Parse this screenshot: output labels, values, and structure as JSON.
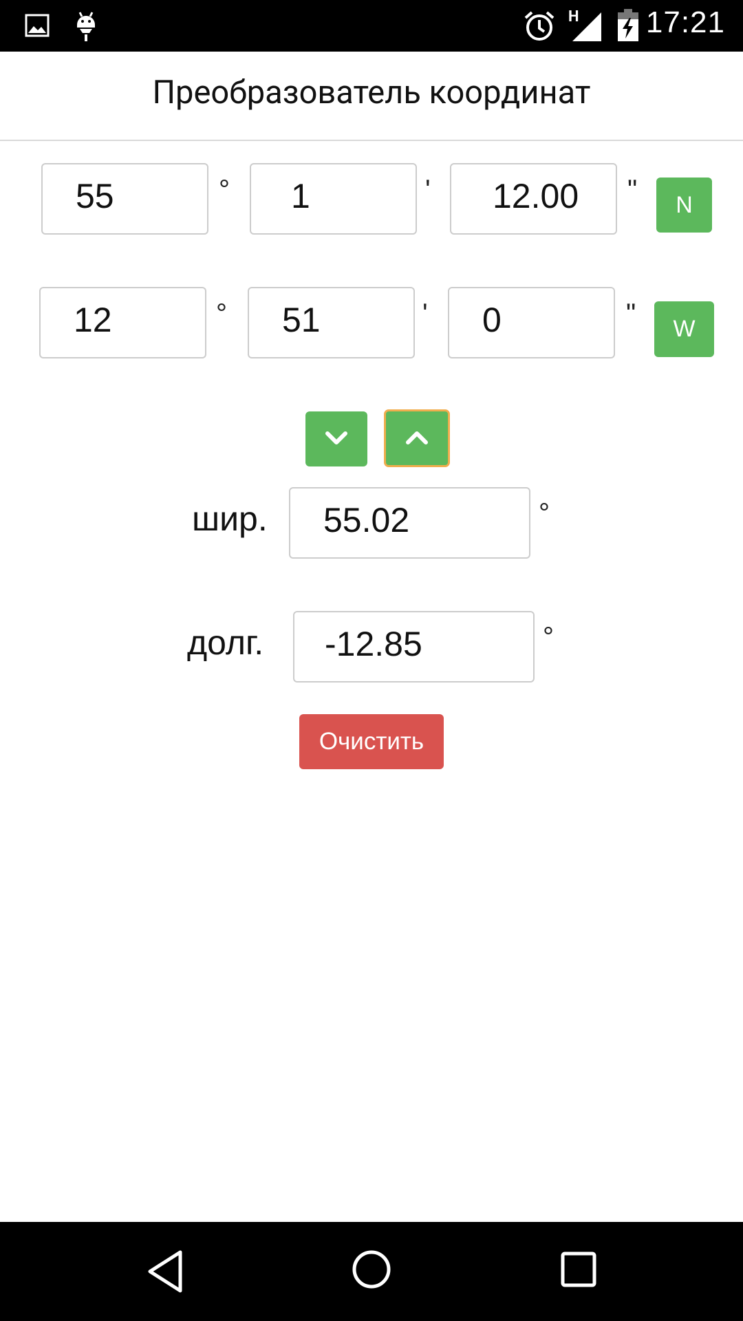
{
  "status_bar": {
    "time": "17:21",
    "network_type": "H",
    "icons": [
      "image-icon",
      "android-debug-icon",
      "alarm-icon",
      "signal-icon",
      "battery-charging-icon"
    ]
  },
  "header": {
    "title": "Преобразователь координат"
  },
  "dms": {
    "latitude": {
      "degrees": "55",
      "minutes": "1",
      "seconds": "12.00",
      "hemisphere": "N"
    },
    "longitude": {
      "degrees": "12",
      "minutes": "51",
      "seconds": "0",
      "hemisphere": "W"
    },
    "symbols": {
      "degree": "°",
      "minute": "'",
      "second": "\""
    }
  },
  "convert": {
    "down_icon": "chevron-down-icon",
    "up_icon": "chevron-up-icon"
  },
  "decimal": {
    "lat_label": "шир.",
    "lat_value": "55.02",
    "lon_label": "долг.",
    "lon_value": "-12.85",
    "unit": "°"
  },
  "actions": {
    "clear_label": "Очистить"
  },
  "colors": {
    "green": "#5cb85c",
    "red": "#d9534f",
    "focus_outline": "#f0ad4e"
  }
}
